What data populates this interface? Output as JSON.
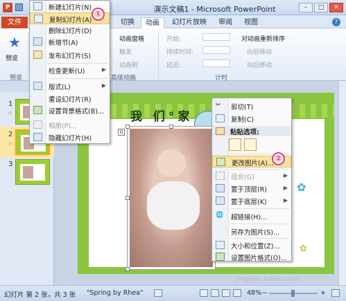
{
  "window": {
    "title": "演示文稿1 - Microsoft PowerPoint",
    "minimize": "–",
    "maximize": "□",
    "close": "✕"
  },
  "ribbon_tabs": {
    "file": "文件",
    "tabs": [
      "切换",
      "动画",
      "幻灯片放映",
      "审阅",
      "视图"
    ],
    "active_index": 1
  },
  "ribbon": {
    "preview_label": "预览",
    "preview_group": "预览",
    "anim_pane": "动画窗格",
    "trigger": "触发",
    "anim_brush": "动画刷",
    "advanced_group": "高级动画",
    "start_label": "开始:",
    "duration_label": "持续时间:",
    "delay_label": "延迟:",
    "timing_group": "计时",
    "reorder_label": "对动画重新排序",
    "move_earlier": "向前移动",
    "move_later": "向后移动"
  },
  "slides_pane": {
    "numbers": [
      "1",
      "2",
      "3"
    ],
    "selected_index": 1
  },
  "slide": {
    "title": "我 们°家"
  },
  "slide_menu": {
    "items": [
      {
        "label": "新建幻灯片(N)",
        "disabled": false,
        "submenu": false
      },
      {
        "label": "复制幻灯片(A)",
        "disabled": false,
        "submenu": false,
        "highlight": true
      },
      {
        "label": "删除幻灯片(D)",
        "disabled": false,
        "submenu": false
      },
      {
        "label": "新增节(A)",
        "disabled": false,
        "submenu": false
      },
      {
        "label": "发布幻灯片(S)",
        "disabled": false,
        "submenu": false
      },
      {
        "label": "检查更新(U)",
        "disabled": false,
        "submenu": true
      },
      {
        "label": "版式(L)",
        "disabled": false,
        "submenu": true
      },
      {
        "label": "重设幻灯片(R)",
        "disabled": false,
        "submenu": false
      },
      {
        "label": "设置背景格式(B)...",
        "disabled": false,
        "submenu": false
      },
      {
        "label": "相册(P)...",
        "disabled": true,
        "submenu": false
      },
      {
        "label": "隐藏幻灯片(H)",
        "disabled": false,
        "submenu": false
      }
    ]
  },
  "picture_menu": {
    "cut": "剪切(T)",
    "copy": "复制(C)",
    "paste_options": "粘贴选项:",
    "change_picture": "更改图片(A)...",
    "group": "组合(G)",
    "bring_front": "置于顶层(R)",
    "send_back": "置于底层(K)",
    "hyperlink": "超链接(H)...",
    "save_as_picture": "另存为图片(S)...",
    "size_position": "大小和位置(Z)...",
    "format_picture": "设置图片格式(O)..."
  },
  "callouts": {
    "first": "①",
    "second": "②"
  },
  "statusbar": {
    "slide_info": "幻灯片 第 2 张，共 3 张",
    "theme": "\"Spring by Rhea\"",
    "zoom": "48%",
    "zoom_minus": "−",
    "zoom_plus": "+"
  },
  "watermark": "jingyan.baidu.com"
}
